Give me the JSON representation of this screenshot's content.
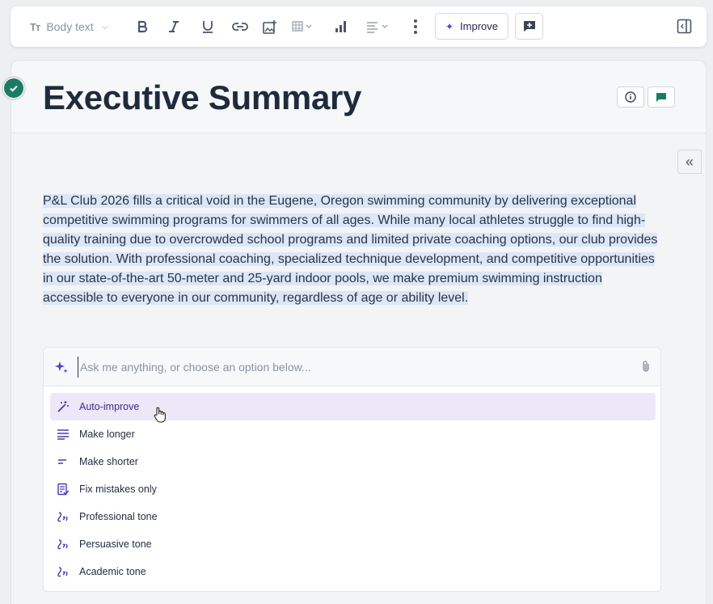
{
  "toolbar": {
    "style_icon": "Tт",
    "style_label": "Body text",
    "improve_label": "Improve"
  },
  "document": {
    "title": "Executive Summary",
    "paragraph": "P&L Club 2026 fills a critical void in the Eugene, Oregon swimming community by delivering exceptional competitive swimming programs for swimmers of all ages. While many local athletes struggle to find high-quality training due to overcrowded school programs and limited private coaching options, our club provides the solution. With professional coaching, specialized technique development, and competitive opportunities in our state-of-the-art 50-meter and 25-yard indoor pools, we make premium swimming instruction accessible to everyone in our community, regardless of age or ability level."
  },
  "ai": {
    "placeholder": "Ask me anything, or choose an option below...",
    "options": [
      {
        "label": "Auto-improve",
        "icon": "magic-wand-icon"
      },
      {
        "label": "Make longer",
        "icon": "lines-long-icon"
      },
      {
        "label": "Make shorter",
        "icon": "lines-short-icon"
      },
      {
        "label": "Fix mistakes only",
        "icon": "spellcheck-icon"
      },
      {
        "label": "Professional tone",
        "icon": "tone-icon"
      },
      {
        "label": "Persuasive tone",
        "icon": "tone-icon"
      },
      {
        "label": "Academic tone",
        "icon": "tone-icon"
      }
    ]
  },
  "colors": {
    "accent": "#5b3fc4",
    "selection": "#dbe7f7",
    "check": "#1b7c63"
  }
}
